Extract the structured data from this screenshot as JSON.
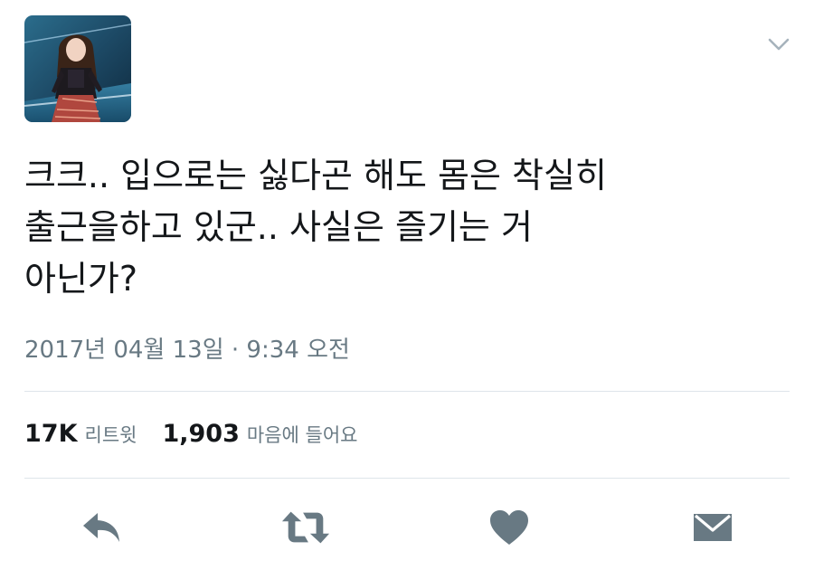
{
  "tweet": {
    "avatar_description": "profile photo",
    "text_lines": [
      "크크.. 입으로는 싫다곤 해도 몸은 착실히",
      "출근을하고 있군.. 사실은 즐기는 거",
      "아닌가?"
    ],
    "timestamp": "2017년 04월 13일 · 9:34 오전"
  },
  "stats": {
    "retweet_count": "17K",
    "retweet_label": "리트윗",
    "like_count": "1,903",
    "like_label": "마음에 들어요"
  },
  "actions": {
    "icons": [
      "reply-icon",
      "retweet-icon",
      "like-icon",
      "message-icon"
    ]
  },
  "colors": {
    "text": "#14171a",
    "secondary": "#687983",
    "icon": "#687983",
    "divider": "#dee5ea"
  }
}
